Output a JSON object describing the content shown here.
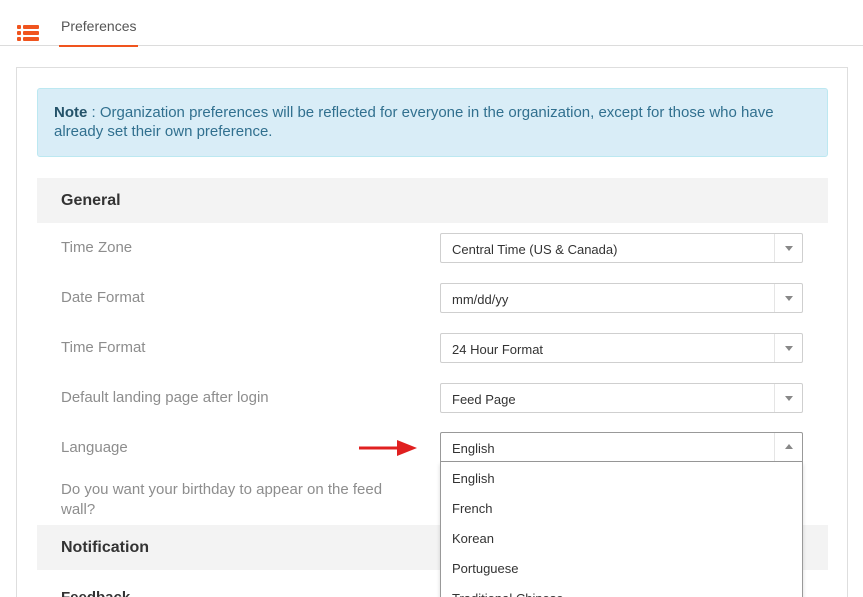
{
  "header": {
    "tab_label": "Preferences"
  },
  "note": {
    "prefix": "Note",
    "text": " : Organization preferences will be reflected for everyone in the organization, except for those who have already set their own preference."
  },
  "general": {
    "title": "General",
    "fields": {
      "timezone": {
        "label": "Time Zone",
        "value": "Central Time (US & Canada)"
      },
      "date_format": {
        "label": "Date Format",
        "value": "mm/dd/yy"
      },
      "time_format": {
        "label": "Time Format",
        "value": "24 Hour Format"
      },
      "landing_page": {
        "label": "Default landing page after login",
        "value": "Feed Page"
      },
      "language": {
        "label": "Language",
        "value": "English"
      },
      "birthday": {
        "label": "Do you want your birthday to appear on the feed wall?"
      }
    }
  },
  "language_options": [
    "English",
    "French",
    "Korean",
    "Portuguese",
    "Traditional Chinese"
  ],
  "notification": {
    "title": "Notification",
    "feedback_label": "Feedback"
  },
  "colors": {
    "accent": "#f0541e",
    "arrow": "#e02020",
    "note_bg": "#d9edf7",
    "note_text": "#31708f"
  }
}
